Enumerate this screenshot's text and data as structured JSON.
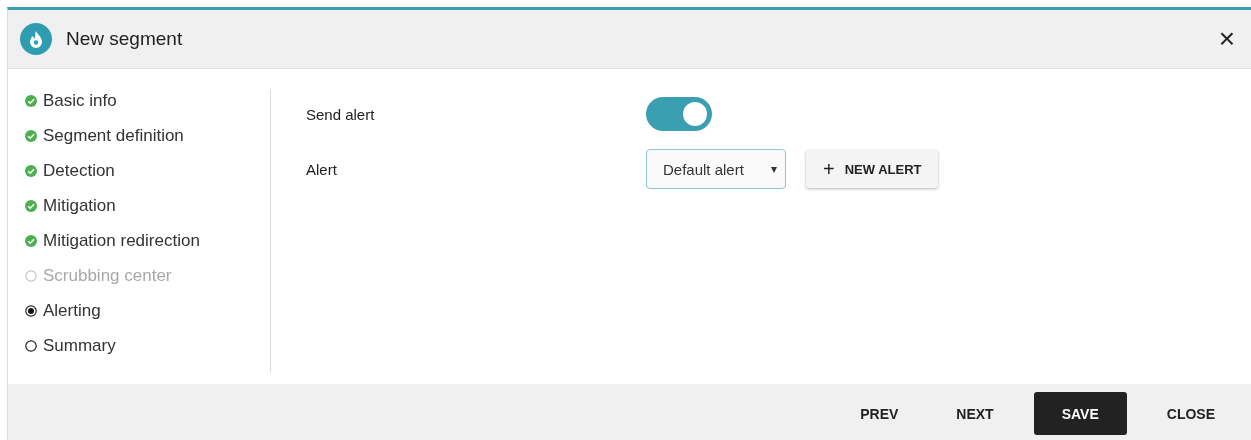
{
  "dialog": {
    "title": "New segment",
    "close": "×"
  },
  "steps": [
    {
      "label": "Basic info",
      "done": true,
      "disabled": false,
      "selected": false
    },
    {
      "label": "Segment definition",
      "done": true,
      "disabled": false,
      "selected": false
    },
    {
      "label": "Detection",
      "done": true,
      "disabled": false,
      "selected": false
    },
    {
      "label": "Mitigation",
      "done": true,
      "disabled": false,
      "selected": false
    },
    {
      "label": "Mitigation redirection",
      "done": true,
      "disabled": false,
      "selected": false
    },
    {
      "label": "Scrubbing center",
      "done": false,
      "disabled": true,
      "selected": false
    },
    {
      "label": "Alerting",
      "done": false,
      "disabled": false,
      "selected": true
    },
    {
      "label": "Summary",
      "done": false,
      "disabled": false,
      "selected": false
    }
  ],
  "form": {
    "send_alert": {
      "label": "Send alert",
      "on": true
    },
    "alert": {
      "label": "Alert",
      "value": "Default alert",
      "caret": "▾",
      "new_button": {
        "icon": "+",
        "label": "NEW ALERT"
      }
    }
  },
  "footer": {
    "buttons": [
      {
        "label": "PREV",
        "kind": "text"
      },
      {
        "label": "NEXT",
        "kind": "text"
      },
      {
        "label": "SAVE",
        "kind": "primary"
      },
      {
        "label": "CLOSE",
        "kind": "text"
      }
    ]
  }
}
